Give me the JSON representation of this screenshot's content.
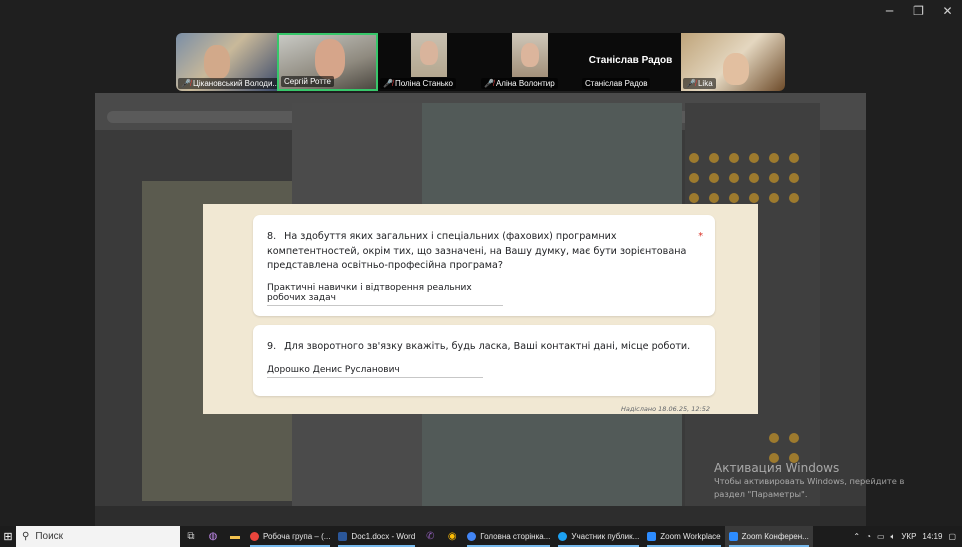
{
  "participants": [
    {
      "name": "Цікановський Володи...",
      "muted": true
    },
    {
      "name": "Сергій Ротте",
      "muted": false,
      "active_speaker": true
    },
    {
      "name": "Поліна Станько",
      "muted": true
    },
    {
      "name": "Аліна Волонтир",
      "muted": true
    },
    {
      "name": "Станіслав Радов",
      "muted": false,
      "big_name": "Станіслав Радов"
    },
    {
      "name": "Lika",
      "muted": true
    }
  ],
  "form": {
    "q8_number": "8.",
    "q8_text": "На здобуття яких загальних і спеціальних (фахових) програмних компетентностей, окрім тих, що зазначені, на Вашу думку, має бути зорієнтована представлена освітньо-професійна програма?",
    "q8_required": "*",
    "q8_answer": "Практичні навички і відтворення реальних робочих задач",
    "q9_number": "9.",
    "q9_text": "Для зворотного зв'язку вкажіть, будь ласка, Ваші контактні дані, місце роботи.",
    "q9_answer": "Дорошко Денис Русланович",
    "sent_label": "Надіслано 18.06.25, 12:52"
  },
  "activation": {
    "title": "Активация Windows",
    "subtitle": "Чтобы активировать Windows, перейдите в раздел \"Параметры\"."
  },
  "taskbar": {
    "search_label": "Поиск",
    "apps": [
      {
        "label": "Робоча група – (...",
        "color": "#e8453c",
        "active": false,
        "underline": true
      },
      {
        "label": "Doc1.docx - Word",
        "color": "#2b579a",
        "active": false,
        "underline": true
      },
      {
        "label": "Головна сторінка...",
        "color": "#4285f4",
        "active": false,
        "underline": true
      },
      {
        "label": "Участник публик...",
        "color": "#1da1f2",
        "active": false,
        "underline": true
      },
      {
        "label": "Zoom Workplace",
        "color": "#2d8cff",
        "active": false,
        "underline": true
      },
      {
        "label": "Zoom Конферен...",
        "color": "#2d8cff",
        "active": true,
        "underline": true
      }
    ],
    "language": "УКР",
    "time": "14:19"
  },
  "colors": {
    "active_speaker_border": "#37c76a",
    "form_background": "#f1e8d3",
    "required": "#d93025",
    "taskbar": "#1c1c1c"
  }
}
